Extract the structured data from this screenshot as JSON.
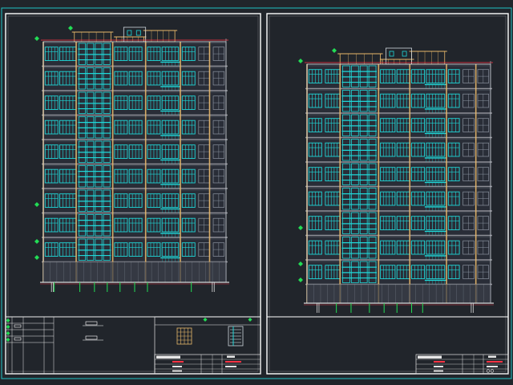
{
  "canvas": {
    "background": "#21252b",
    "frame_color": "#20c4c4",
    "sheet_color": "#ffffff"
  },
  "palette": {
    "window": "#20d8d8",
    "column": "#e8b86a",
    "floor_line": "#9a9aa2",
    "ground": "#ff3344",
    "node": "#22dd55",
    "title_block": "#e6e6e6",
    "red_text": "#ff3344"
  },
  "drawing": {
    "sheets": [
      {
        "name": "elevation-sheet-1",
        "floors": 9
      },
      {
        "name": "elevation-sheet-2",
        "floors": 9
      }
    ],
    "building_components": [
      "elevation-outline",
      "window-grid",
      "floor-lines",
      "stair-core",
      "roof-parapet",
      "pilotis-ground",
      "level-markers"
    ]
  }
}
